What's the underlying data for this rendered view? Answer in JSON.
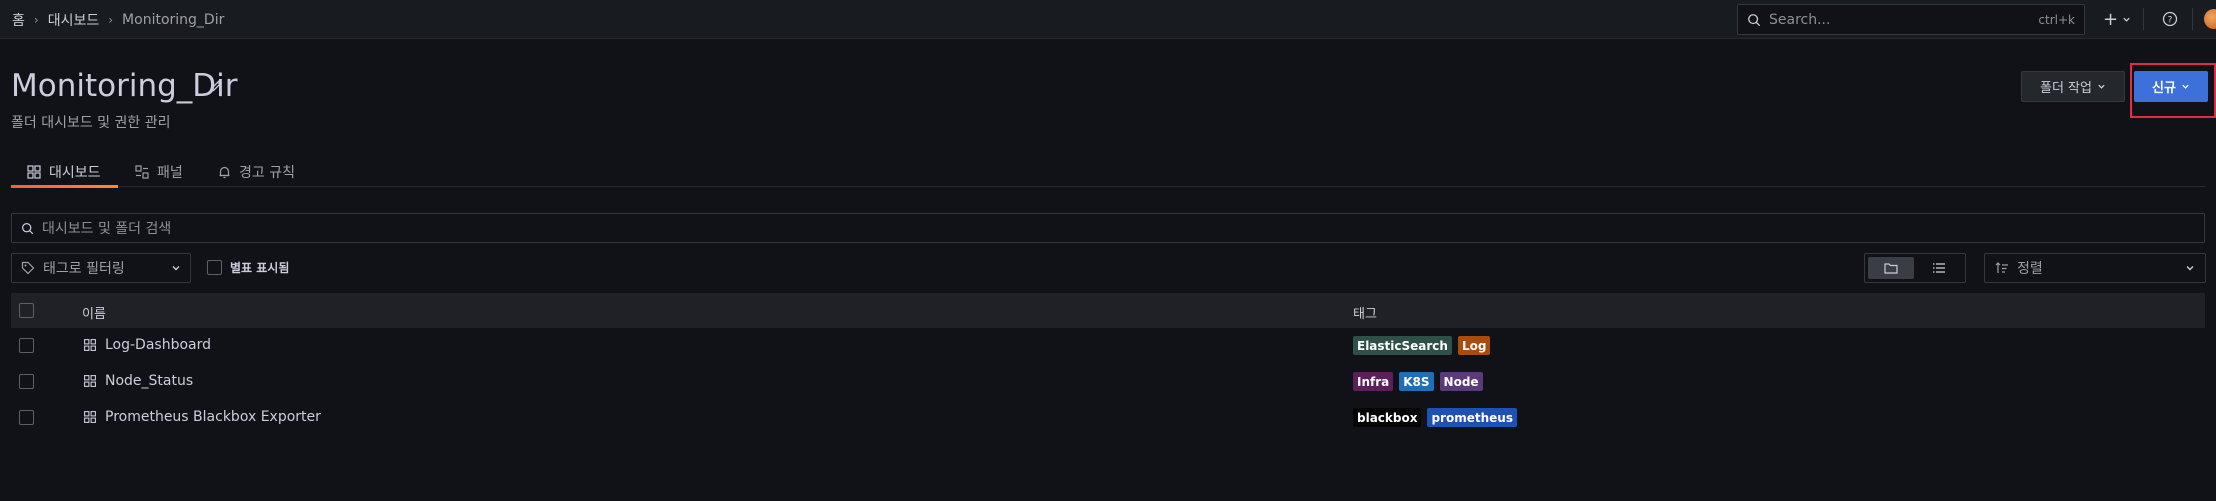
{
  "breadcrumb": {
    "home": "홈",
    "dashboards": "대시보드",
    "current": "Monitoring_Dir"
  },
  "topbar": {
    "search_placeholder": "Search...",
    "search_shortcut": "ctrl+k",
    "add_label": "+",
    "help_icon": "help-icon"
  },
  "header": {
    "title": "Monitoring_Dir",
    "subtitle": "폴더 대시보드 및 권한 관리",
    "folder_actions_label": "폴더 작업",
    "new_label": "신규"
  },
  "tabs": [
    {
      "label": "대시보드",
      "icon": "apps-icon",
      "active": true
    },
    {
      "label": "패널",
      "icon": "library-panel-icon",
      "active": false
    },
    {
      "label": "경고 규칙",
      "icon": "bell-icon",
      "active": false
    }
  ],
  "filters": {
    "search_placeholder": "대시보드 및 폴더 검색",
    "tag_filter_placeholder": "태그로 필터링",
    "starred_label": "별표 표시됨",
    "sort_placeholder": "정렬"
  },
  "table": {
    "columns": [
      "이름",
      "태그"
    ],
    "rows": [
      {
        "name": "Log-Dashboard",
        "tags": [
          {
            "label": "ElasticSearch",
            "color": "#2f5049"
          },
          {
            "label": "Log",
            "color": "#a84d0e"
          }
        ]
      },
      {
        "name": "Node_Status",
        "tags": [
          {
            "label": "Infra",
            "color": "#5c1f5c"
          },
          {
            "label": "K8S",
            "color": "#1f6fb5"
          },
          {
            "label": "Node",
            "color": "#5a3a7a"
          }
        ]
      },
      {
        "name": "Prometheus Blackbox Exporter",
        "tags": [
          {
            "label": "blackbox",
            "color": "#050505"
          },
          {
            "label": "prometheus",
            "color": "#1f50b5"
          }
        ]
      }
    ]
  },
  "colors": {
    "accent": "#3d71d9",
    "highlight_border": "#e02f44",
    "tab_underline": "#f55f3e"
  }
}
